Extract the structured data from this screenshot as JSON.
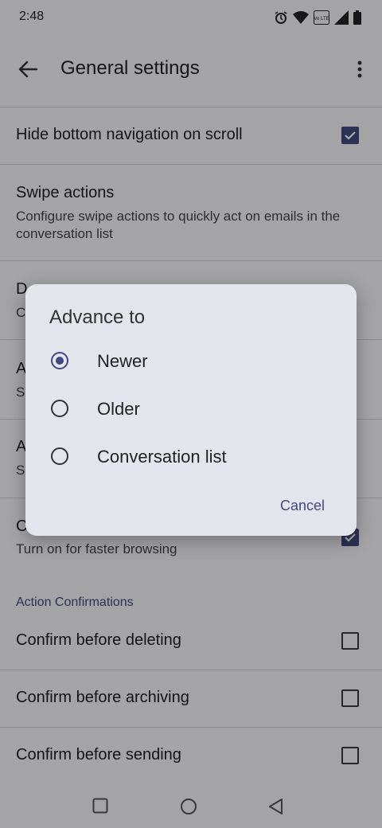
{
  "status": {
    "time": "2:48",
    "icons": [
      "alarm-icon",
      "wifi-icon",
      "volte-icon",
      "signal-icon",
      "battery-icon"
    ],
    "volte_text": "Vo LTE"
  },
  "appbar": {
    "title": "General settings"
  },
  "settings": {
    "hide_nav": {
      "title": "Hide bottom navigation on scroll",
      "checked": true
    },
    "swipe": {
      "title": "Swipe actions",
      "subtitle": "Configure swipe actions to quickly act on emails in the conversation list"
    },
    "default_notif": {
      "title_visible": "D",
      "subtitle_visible": "C"
    },
    "auto_advance": {
      "title_visible": "A",
      "subtitle_visible": "S"
    },
    "auto_fit": {
      "title_visible": "A",
      "subtitle_visible": "S"
    },
    "convo_view": {
      "title_visible": "C",
      "subtitle": "Turn on for faster browsing",
      "checked": true
    },
    "section_action": "Action Confirmations",
    "confirm_delete": {
      "title": "Confirm before deleting",
      "checked": false
    },
    "confirm_archive": {
      "title": "Confirm before archiving",
      "checked": false
    },
    "confirm_send": {
      "title": "Confirm before sending",
      "checked": false
    }
  },
  "dialog": {
    "title": "Advance to",
    "options": [
      {
        "label": "Newer",
        "selected": true
      },
      {
        "label": "Older",
        "selected": false
      },
      {
        "label": "Conversation list",
        "selected": false
      }
    ],
    "cancel": "Cancel"
  },
  "colors": {
    "accent": "#41497f",
    "dialog_bg": "#e4e4ec",
    "screen_bg": "#f2f2f5"
  }
}
